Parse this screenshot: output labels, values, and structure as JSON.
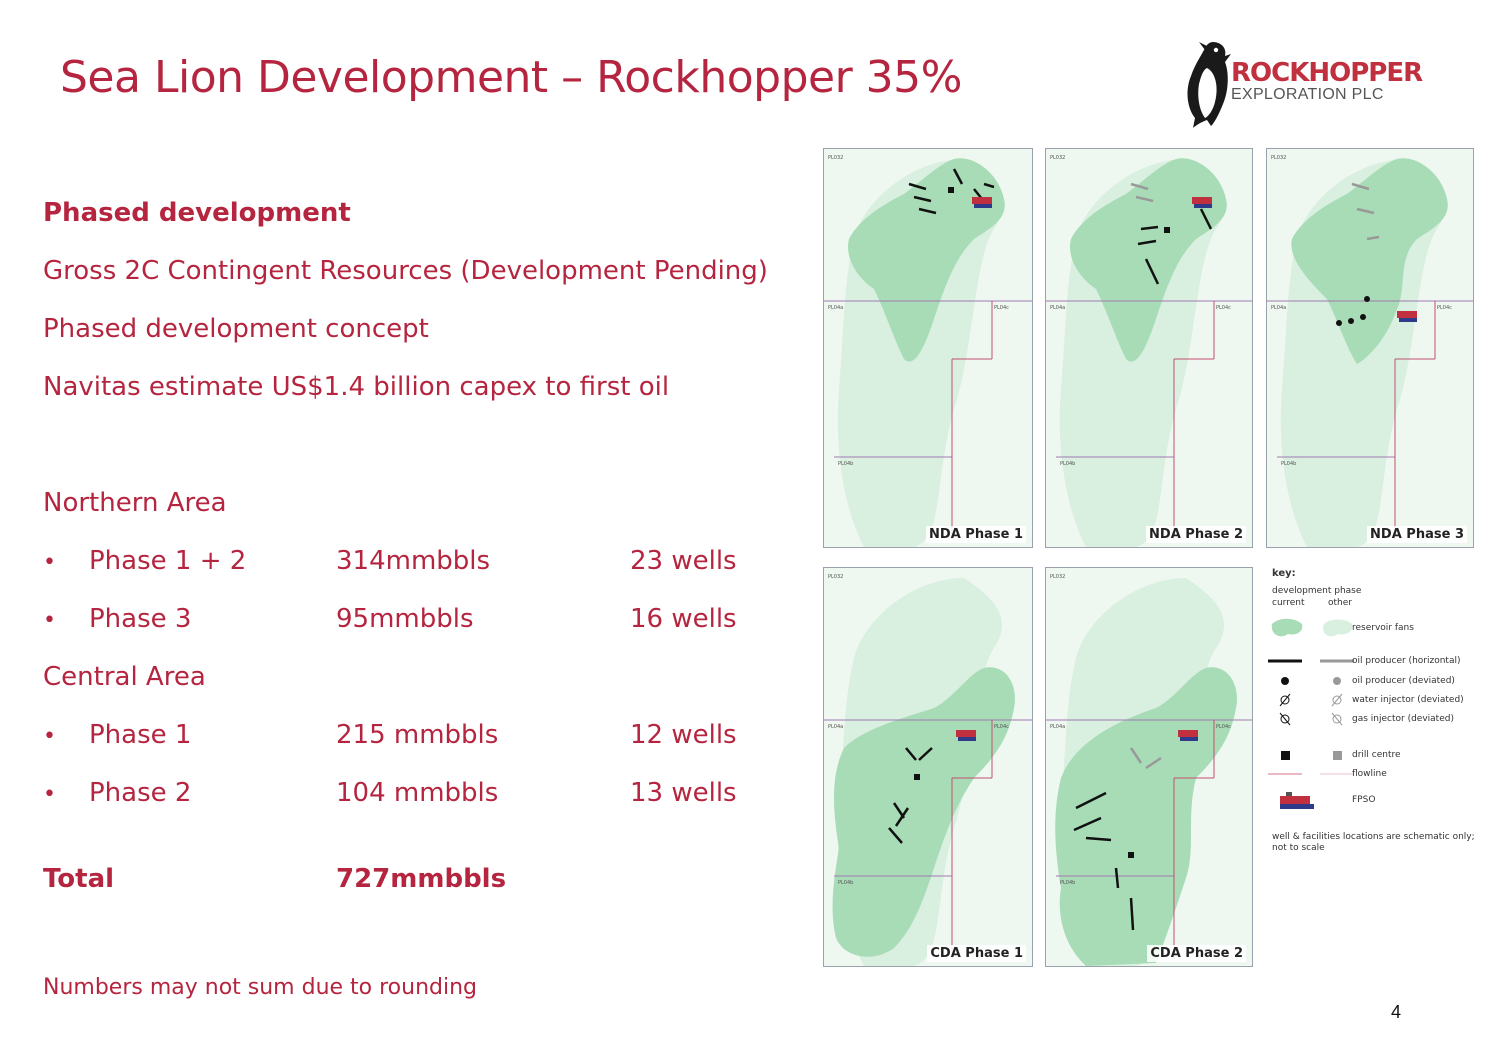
{
  "title": "Sea Lion Development – Rockhopper 35%",
  "logo": {
    "name": "ROCKHOPPER",
    "subtitle": "EXPLORATION PLC"
  },
  "intro": {
    "heading": "Phased development",
    "lines": [
      "Gross 2C Contingent Resources (Development Pending)",
      "Phased development concept",
      "Navitas estimate US$1.4 billion capex to first oil"
    ]
  },
  "northern": {
    "heading": "Northern Area",
    "rows": [
      {
        "bullet": "•",
        "phase": "Phase 1 + 2",
        "volume": "314mmbbls",
        "wells": "23 wells"
      },
      {
        "bullet": "•",
        "phase": "Phase 3",
        "volume": "95mmbbls",
        "wells": "16 wells"
      }
    ]
  },
  "central": {
    "heading": "Central Area",
    "rows": [
      {
        "bullet": "•",
        "phase": "Phase 1",
        "volume": "215 mmbbls",
        "wells": "12 wells"
      },
      {
        "bullet": "•",
        "phase": "Phase 2",
        "volume": "104 mmbbls",
        "wells": "13 wells"
      }
    ]
  },
  "total": {
    "label": "Total",
    "value": "727mmbbls"
  },
  "footnote": "Numbers may not sum due to rounding",
  "panels": [
    {
      "label": "NDA Phase 1",
      "blocks": [
        "PL032",
        "PL04a",
        "PL04c",
        "PL04b"
      ]
    },
    {
      "label": "NDA Phase 2",
      "blocks": [
        "PL032",
        "PL04a",
        "PL04c",
        "PL04b"
      ]
    },
    {
      "label": "NDA Phase 3",
      "blocks": [
        "PL032",
        "PL04a",
        "PL04c",
        "PL04b"
      ]
    },
    {
      "label": "CDA Phase 1",
      "blocks": [
        "PL032",
        "PL04a",
        "PL04c",
        "PL04b"
      ]
    },
    {
      "label": "CDA Phase 2",
      "blocks": [
        "PL032",
        "PL04a",
        "PL04c",
        "PL04b"
      ]
    }
  ],
  "key": {
    "title": "key:",
    "phase_header": "development phase",
    "current": "current",
    "other": "other",
    "items": {
      "reservoir": "reservoir fans",
      "oil_h": "oil producer (horizontal)",
      "oil_d": "oil producer (deviated)",
      "water": "water injector (deviated)",
      "gas": "gas injector (deviated)",
      "drill": "drill centre",
      "flowline": "flowline",
      "fpso": "FPSO"
    },
    "note1": "well & facilities locations are schematic only;",
    "note2": "not to scale"
  },
  "colors": {
    "accent": "#b5253f",
    "reservoir_current": "#a8dcb6",
    "reservoir_other": "#d9efdf"
  },
  "page_number": "4"
}
